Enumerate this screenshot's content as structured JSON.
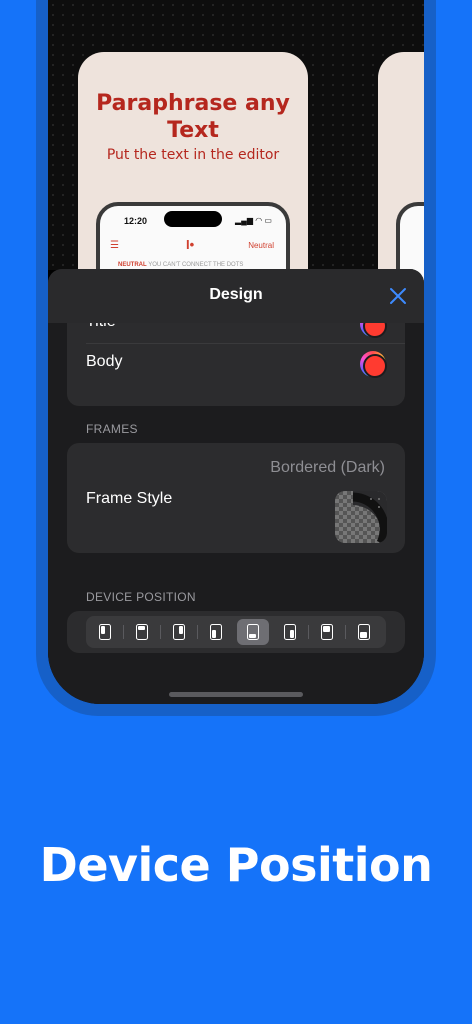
{
  "preview": {
    "card_title": "Paraphrase any Text",
    "card_subtitle": "Put the text in the editor",
    "mini_time": "12:20",
    "mini_status": "▂▄▆ ◠ ▭",
    "mini_logo": "I•",
    "mini_neutral": "Neutral",
    "mini_text_tag": "NEUTRAL",
    "mini_text": "YOU CAN'T CONNECT THE DOTS"
  },
  "sheet": {
    "title": "Design",
    "colors": {
      "title_label": "Title",
      "body_label": "Body"
    },
    "frames_section": "FRAMES",
    "frame_style_label": "Frame Style",
    "frame_style_value": "Bordered (Dark)",
    "device_position_section": "DEVICE POSITION",
    "device_positions": {
      "count": 8,
      "selected_index": 4
    }
  },
  "caption": "Device Position",
  "colors": {
    "background": "#1573F9",
    "phone_frame": "#1660C8",
    "accent_red": "#B5271E",
    "close_blue": "#3D8BFF"
  }
}
